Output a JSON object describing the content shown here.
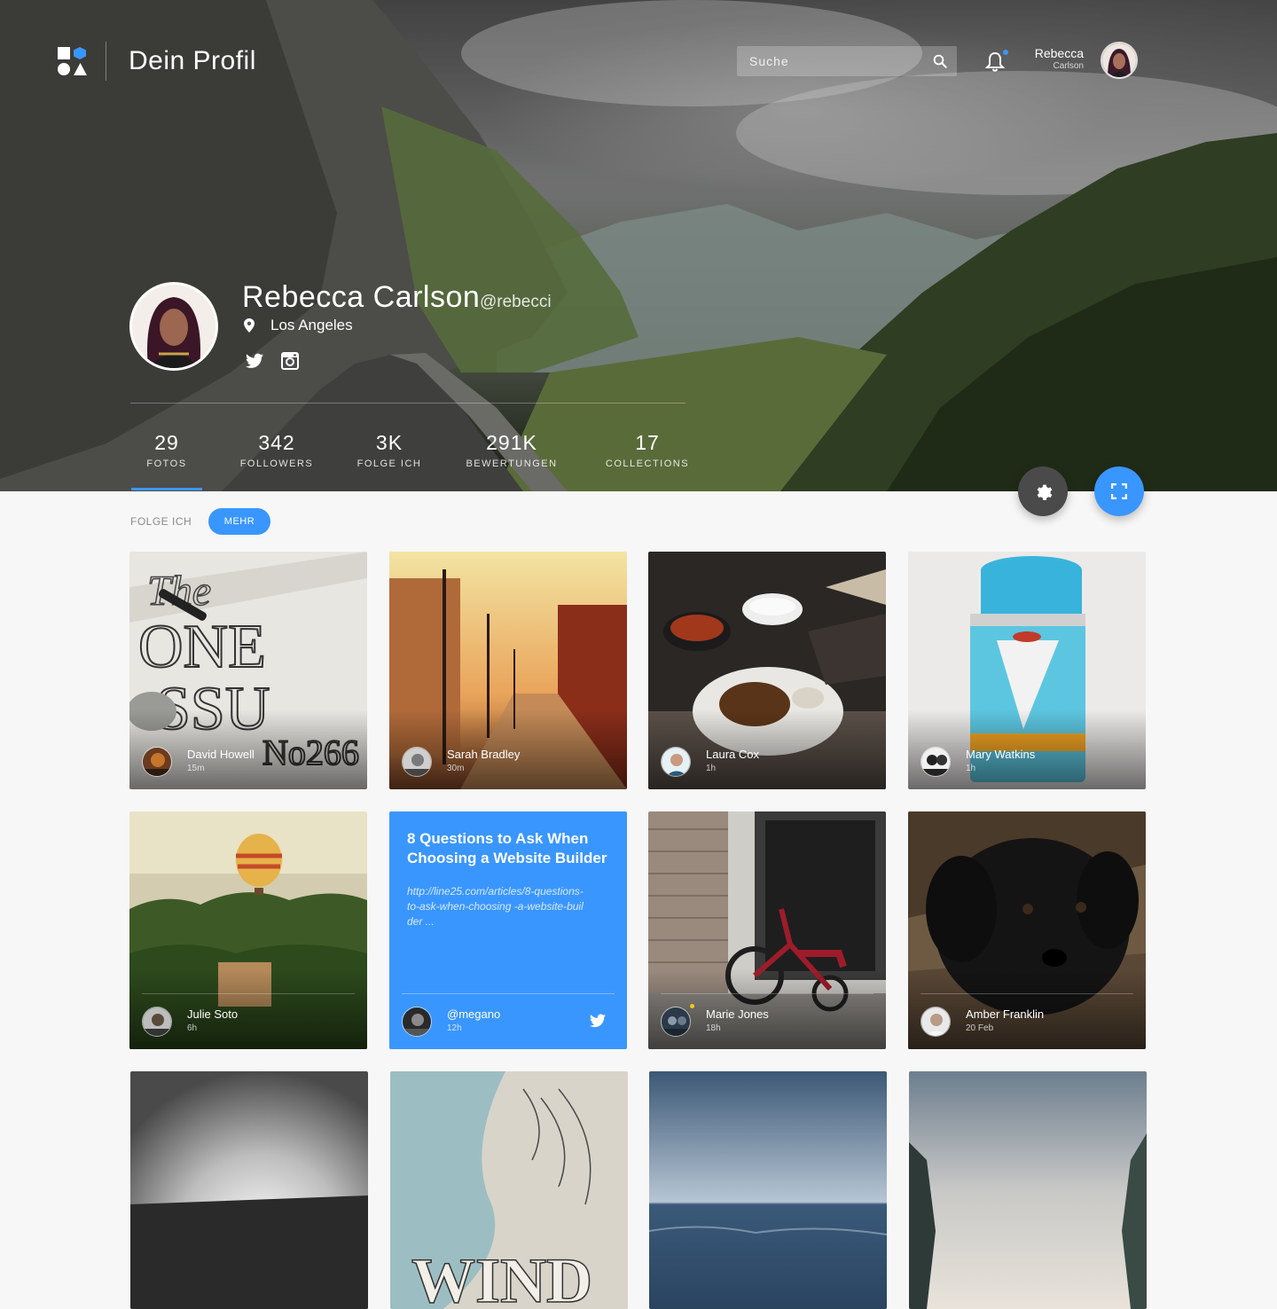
{
  "header": {
    "page_title": "Dein Profil",
    "search_placeholder": "Suche",
    "user_first_name": "Rebecca",
    "user_last_name": "Carlson"
  },
  "profile": {
    "name": "Rebecca Carlson",
    "handle": "@rebecci",
    "location": "Los Angeles",
    "social": [
      "twitter-icon",
      "instagram-icon"
    ]
  },
  "stats": [
    {
      "value": "29",
      "label": "FOTOS",
      "active": true
    },
    {
      "value": "342",
      "label": "FOLLOWERS"
    },
    {
      "value": "3K",
      "label": "FOLGE ICH"
    },
    {
      "value": "291K",
      "label": "BEWERTUNGEN"
    },
    {
      "value": "17",
      "label": "COLLECTIONS"
    }
  ],
  "filters": {
    "label": "FOLGE ICH",
    "pill": "MEHR"
  },
  "cards": [
    {
      "name": "David Howell",
      "time": "15m"
    },
    {
      "name": "Sarah Bradley",
      "time": "30m"
    },
    {
      "name": "Laura Cox",
      "time": "1h"
    },
    {
      "name": "Mary Watkins",
      "time": "1h"
    },
    {
      "name": "Julie Soto",
      "time": "6h"
    },
    {
      "name": "@megano",
      "time": "12h",
      "title": "8 Questions to Ask When Choosing a Website Builder",
      "url": "http://line25.com/articles/8-questions-to-ask-when-choosing -a-website-builder ..."
    },
    {
      "name": "Marie Jones",
      "time": "18h"
    },
    {
      "name": "Amber Franklin",
      "time": "20 Feb"
    }
  ],
  "colors": {
    "accent": "#3a96ff",
    "settings_fab": "#4a4a4a",
    "background": "#f7f7f7"
  }
}
